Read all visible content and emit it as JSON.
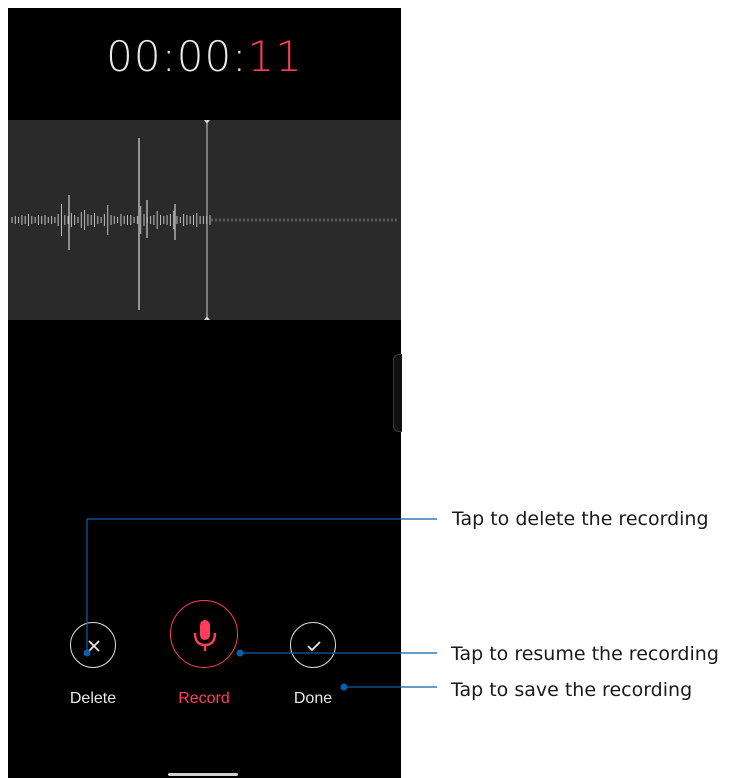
{
  "recorder": {
    "timer": {
      "prefix": "00:00:",
      "seconds": "11"
    },
    "buttons": {
      "delete_label": "Delete",
      "record_label": "Record",
      "done_label": "Done"
    }
  },
  "callouts": {
    "delete": "Tap to delete the recording",
    "resume": "Tap to resume the recording",
    "save": "Tap to save the recording"
  },
  "colors": {
    "accent": "#ff3d5a",
    "callout_line": "#0a5fa8",
    "background": "#000000",
    "wave_panel": "#2a2a2a"
  },
  "icons": {
    "delete": "close-icon",
    "record": "microphone-icon",
    "done": "checkmark-icon"
  }
}
